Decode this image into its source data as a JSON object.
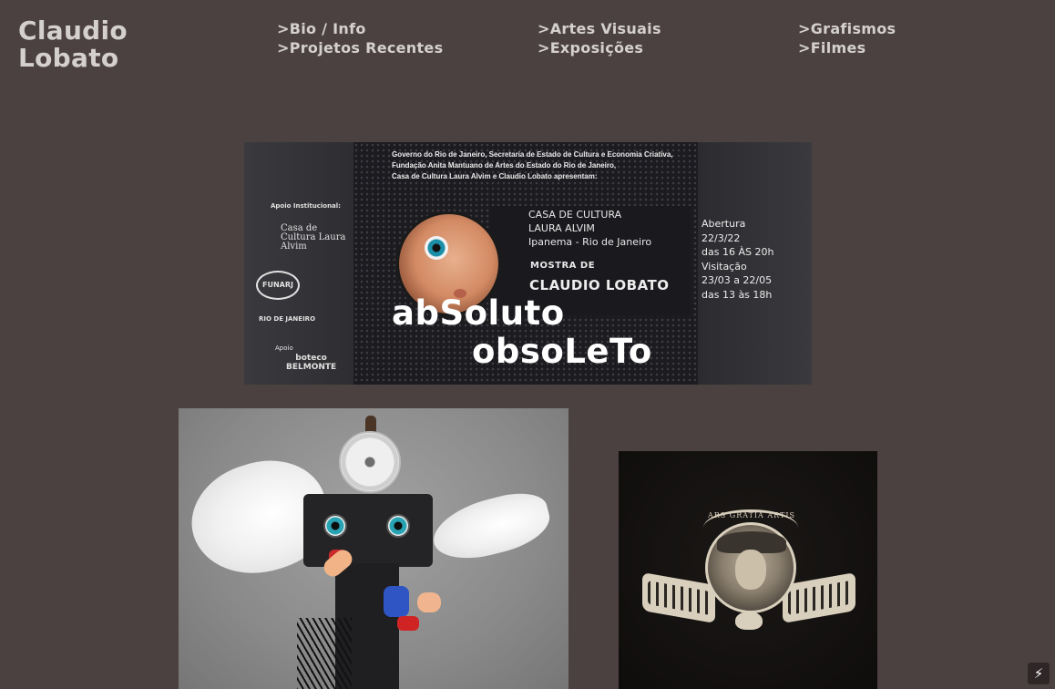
{
  "header": {
    "site_title_line1": "Claudio",
    "site_title_line2": "Lobato"
  },
  "nav": {
    "col1": [
      ">Bio / Info",
      ">Projetos Recentes"
    ],
    "col2": [
      ">Artes Visuais",
      ">Exposições"
    ],
    "col3": [
      ">Grafismos",
      ">Filmes"
    ]
  },
  "poster": {
    "credits": [
      "Governo do Rio de Janeiro, Secretaria de Estado de Cultura e Economia Criativa,",
      "Fundação Anita Mantuano de Artes do Estado do Rio de Janeiro,",
      "Casa de Cultura Laura Alvim e Claudio Lobato apresentam:"
    ],
    "apoio_institucional": "Apoio Institucional:",
    "sponsor_casa": [
      "Casa de",
      "Cultura Laura",
      "Alvim"
    ],
    "sponsor_funarj": "FUNARJ",
    "sponsor_gov": "RIO DE JANEIRO",
    "sponsor_apoio": "Apoio",
    "sponsor_belmonte": [
      "boteco",
      "BELMONTE"
    ],
    "venue": [
      "CASA DE CULTURA",
      "LAURA ALVIM",
      "Ipanema - Rio de Janeiro"
    ],
    "mostra_label": "MOSTRA DE",
    "artist": "CLAUDIO LOBATO",
    "title_line1": "abSoluto",
    "title_line2": "obsoLeTo",
    "dates": [
      "Abertura",
      "22/3/22",
      "das 16 ÀS 20h",
      "Visitação",
      "23/03 a 22/05",
      "das 13 às 18h"
    ]
  },
  "sepia": {
    "emblem_text": "ARS GRATIA ARTIS"
  },
  "corner_button": {
    "icon": "lightning-icon",
    "glyph": "⚡"
  },
  "colors": {
    "background": "#4c4141",
    "nav_text": "#d4d0cf"
  }
}
